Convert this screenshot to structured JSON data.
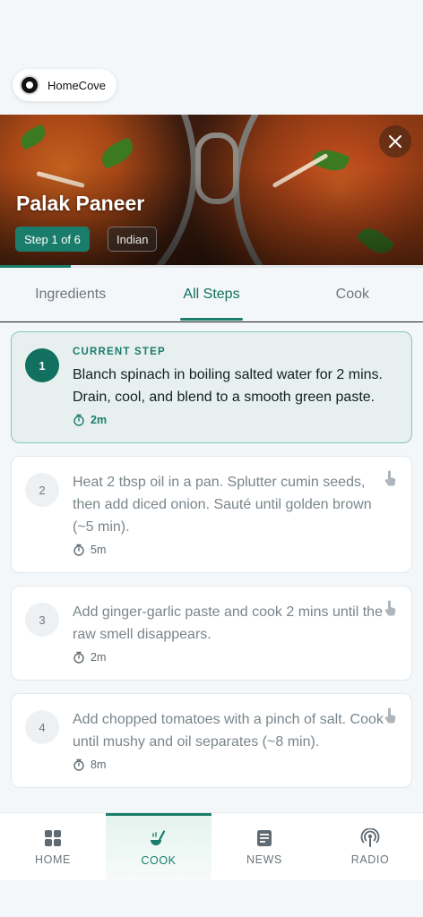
{
  "brand": {
    "name": "HomeCove"
  },
  "recipe": {
    "title": "Palak Paneer",
    "step_badge": "Step 1 of 6",
    "cuisine": "Indian",
    "progress_fraction": 0.1667
  },
  "tabs": [
    {
      "label": "Ingredients",
      "active": false
    },
    {
      "label": "All Steps",
      "active": true
    },
    {
      "label": "Cook",
      "active": false
    }
  ],
  "current_label": "CURRENT STEP",
  "steps": [
    {
      "number": "1",
      "text": "Blanch spinach in boiling salted water for 2 mins. Drain, cool, and blend to a smooth green paste.",
      "time": "2m",
      "current": true
    },
    {
      "number": "2",
      "text": "Heat 2 tbsp oil in a pan. Splutter cumin seeds, then add diced onion. Sauté until golden brown (~5 min).",
      "time": "5m",
      "current": false
    },
    {
      "number": "3",
      "text": "Add ginger-garlic paste and cook 2 mins until the raw smell disappears.",
      "time": "2m",
      "current": false
    },
    {
      "number": "4",
      "text": "Add chopped tomatoes with a pinch of salt. Cook until mushy and oil separates (~8 min).",
      "time": "8m",
      "current": false
    }
  ],
  "nav": [
    {
      "label": "HOME",
      "icon": "grid-icon",
      "active": false
    },
    {
      "label": "COOK",
      "icon": "ladle-icon",
      "active": true
    },
    {
      "label": "NEWS",
      "icon": "news-icon",
      "active": false
    },
    {
      "label": "RADIO",
      "icon": "podcast-icon",
      "active": false
    }
  ],
  "colors": {
    "accent": "#1a7d6b",
    "current_step_bg": "#e8f0ef"
  }
}
